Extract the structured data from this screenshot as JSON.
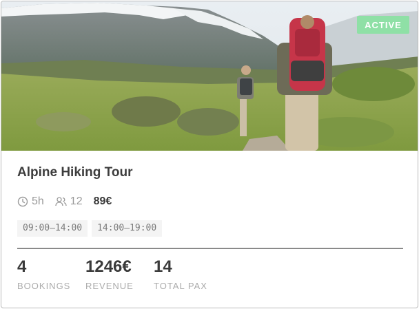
{
  "card": {
    "status_badge": "ACTIVE",
    "title": "Alpine Hiking Tour",
    "meta": {
      "duration": "5h",
      "capacity": "12",
      "price": "89€",
      "duration_icon": "clock-icon",
      "capacity_icon": "people-icon"
    },
    "time_slots": [
      "09:00–14:00",
      "14:00–19:00"
    ],
    "stats": [
      {
        "value": "4",
        "label": "BOOKINGS"
      },
      {
        "value": "1246€",
        "label": "REVENUE"
      },
      {
        "value": "14",
        "label": "TOTAL PAX"
      }
    ]
  },
  "colors": {
    "badge_bg": "#8fe0a6",
    "divider": "#8a8a8a"
  }
}
